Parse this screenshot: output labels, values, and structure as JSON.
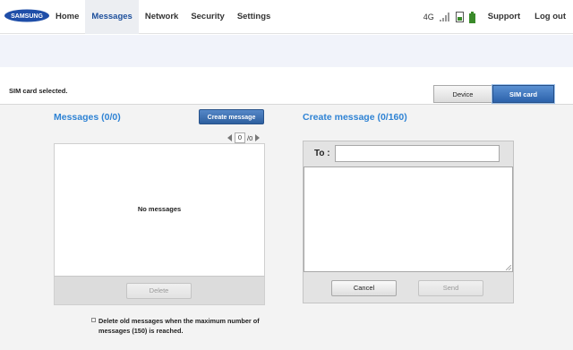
{
  "brand": {
    "logo_text": "SAMSUNG"
  },
  "nav": {
    "items": [
      {
        "label": "Home",
        "active": false
      },
      {
        "label": "Messages",
        "active": true
      },
      {
        "label": "Network",
        "active": false
      },
      {
        "label": "Security",
        "active": false
      },
      {
        "label": "Settings",
        "active": false
      }
    ],
    "network_type": "4G",
    "support_label": "Support",
    "logout_label": "Log out"
  },
  "sim_bar": {
    "status_text": "SIM card selected.",
    "toggle": {
      "device_label": "Device",
      "sim_label": "SIM card",
      "selected": "SIM card"
    }
  },
  "messages_panel": {
    "title": "Messages (0/0)",
    "create_button": "Create message",
    "pager": {
      "current": "0",
      "total": "/0"
    },
    "empty_text": "No messages",
    "delete_button": "Delete",
    "auto_delete_note": "Delete old messages when the maximum number of messages (150) is reached."
  },
  "compose_panel": {
    "title": "Create message (0/160)",
    "to_label": "To :",
    "to_value": "",
    "body_value": "",
    "cancel_button": "Cancel",
    "send_button": "Send"
  },
  "colors": {
    "accent": "#2f83d4",
    "nav_active": "#1d4f9c",
    "primary_button": "#2d5f9f"
  }
}
